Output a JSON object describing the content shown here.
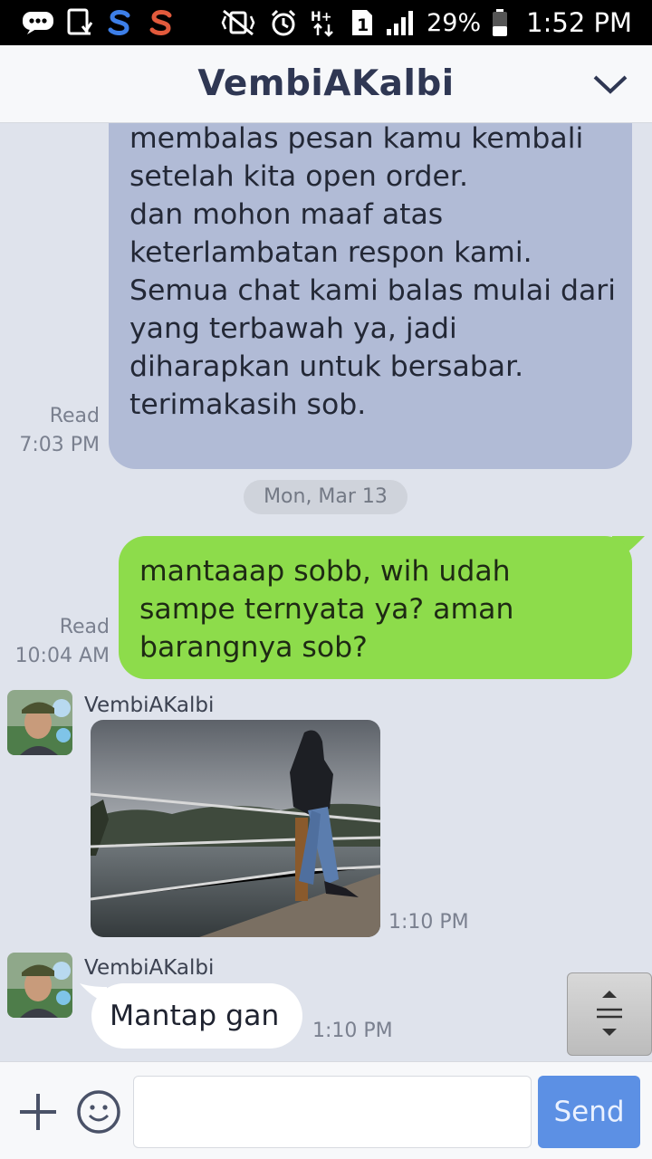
{
  "status_bar": {
    "battery_percent": "29%",
    "time": "1:52 PM",
    "sim_slot": "1",
    "network_type": "H+",
    "icons": [
      "chat-bubble-icon",
      "download-icon",
      "s-app-icon",
      "s-app-icon",
      "vibrate-mute-icon",
      "alarm-icon",
      "network-type-icon",
      "sim-icon",
      "signal-icon",
      "battery-icon"
    ]
  },
  "header": {
    "title": "VembiAKalbi",
    "menu_icon": "chevron-down-icon"
  },
  "messages": {
    "first": {
      "lines": [
        "membalas pesan kamu kembali",
        "setelah kita open order.",
        "dan mohon maaf atas",
        "keterlambatan respon kami.",
        "Semua chat kami balas mulai dari",
        "yang terbawah ya, jadi",
        "diharapkan untuk bersabar.",
        "",
        "terimakasih sob."
      ],
      "read": "Read",
      "time": "7:03 PM"
    },
    "date_divider": "Mon, Mar 13",
    "second": {
      "lines": [
        "mantaaap sobb, wih udah",
        "sampe ternyata ya? aman",
        "barangnya sob?"
      ],
      "read": "Read",
      "time": "10:04 AM"
    },
    "photo_message": {
      "sender": "VembiAKalbi",
      "time": "1:10 PM"
    },
    "text_message": {
      "sender": "VembiAKalbi",
      "text": "Mantap gan",
      "time": "1:10 PM"
    }
  },
  "input_bar": {
    "placeholder": "",
    "value": "",
    "send_label": "Send"
  },
  "colors": {
    "outgoing_blue": "#b1bbd6",
    "outgoing_green": "#8ddc4b",
    "send_button": "#5c90e4",
    "title": "#2f3753",
    "background": "#dfe3ec"
  }
}
